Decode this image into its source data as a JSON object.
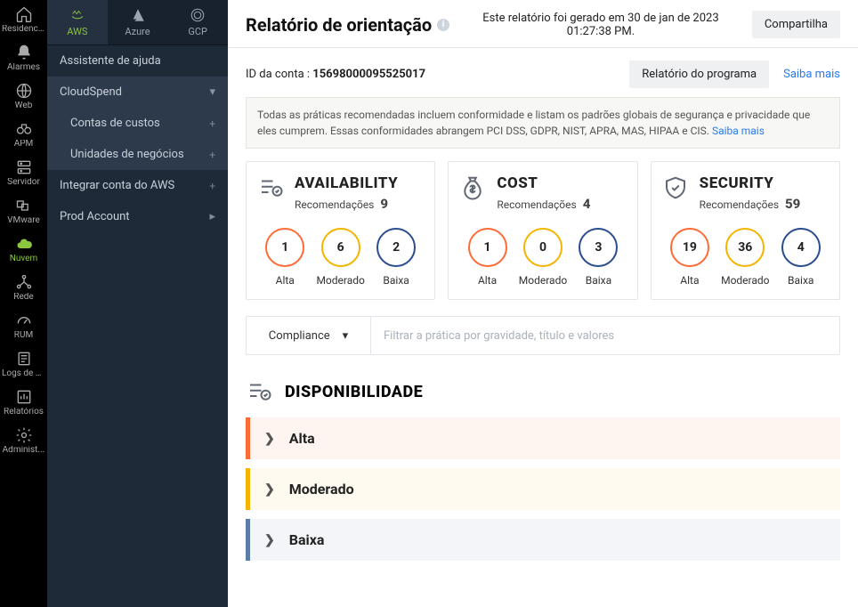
{
  "rail": [
    {
      "name": "home",
      "label": "Residencial"
    },
    {
      "name": "alarms",
      "label": "Alarmes"
    },
    {
      "name": "web",
      "label": "Web"
    },
    {
      "name": "apm",
      "label": "APM"
    },
    {
      "name": "server",
      "label": "Servidor"
    },
    {
      "name": "vmware",
      "label": "VMware"
    },
    {
      "name": "cloud",
      "label": "Nuvem",
      "active": true
    },
    {
      "name": "network",
      "label": "Rede"
    },
    {
      "name": "rum",
      "label": "RUM"
    },
    {
      "name": "logs",
      "label": "Logs de a..."
    },
    {
      "name": "reports",
      "label": "Relatórios"
    },
    {
      "name": "admin",
      "label": "Administ..."
    }
  ],
  "tabs": [
    {
      "name": "aws",
      "label": "AWS",
      "active": true
    },
    {
      "name": "azure",
      "label": "Azure"
    },
    {
      "name": "gcp",
      "label": "GCP"
    }
  ],
  "side": {
    "help": "Assistente de ajuda",
    "cloudspend": "CloudSpend",
    "cost_accounts": "Contas de custos",
    "business_units": "Unidades de negócios",
    "integrate": "Integrar conta do AWS",
    "prod": "Prod Account"
  },
  "header": {
    "title": "Relatório de orientação",
    "generated": "Este relatório foi gerado em 30 de jan de 2023 01:27:38 PM.",
    "share": "Compartilha"
  },
  "account": {
    "id_label": "ID da conta :",
    "id_value": "15698000095525017",
    "program_btn": "Relatório do programa",
    "learn_more": "Saiba mais"
  },
  "notice": {
    "text": "Todas as práticas recomendadas incluem conformidade e listam os padrões globais de segurança e privacidade que eles cumprem. Essas conformidades abrangem PCI DSS, GDPR, NIST, APRA, MAS, HIPAA e CIS.",
    "link": "Saiba mais"
  },
  "cards": [
    {
      "key": "availability",
      "title": "AVAILABILITY",
      "rec_label": "Recomendações",
      "rec_count": "9",
      "high": "1",
      "mod": "6",
      "low": "2"
    },
    {
      "key": "cost",
      "title": "COST",
      "rec_label": "Recomendações",
      "rec_count": "4",
      "high": "1",
      "mod": "0",
      "low": "3"
    },
    {
      "key": "security",
      "title": "SECURITY",
      "rec_label": "Recomendações",
      "rec_count": "59",
      "high": "19",
      "mod": "36",
      "low": "4"
    }
  ],
  "severity_labels": {
    "high": "Alta",
    "mod": "Moderado",
    "low": "Baixa"
  },
  "filter": {
    "select": "Compliance",
    "placeholder": "Filtrar a prática por gravidade, título e valores"
  },
  "section": {
    "title": "DISPONIBILIDADE"
  },
  "accordion": {
    "high": "Alta",
    "mod": "Moderado",
    "low": "Baixa"
  }
}
